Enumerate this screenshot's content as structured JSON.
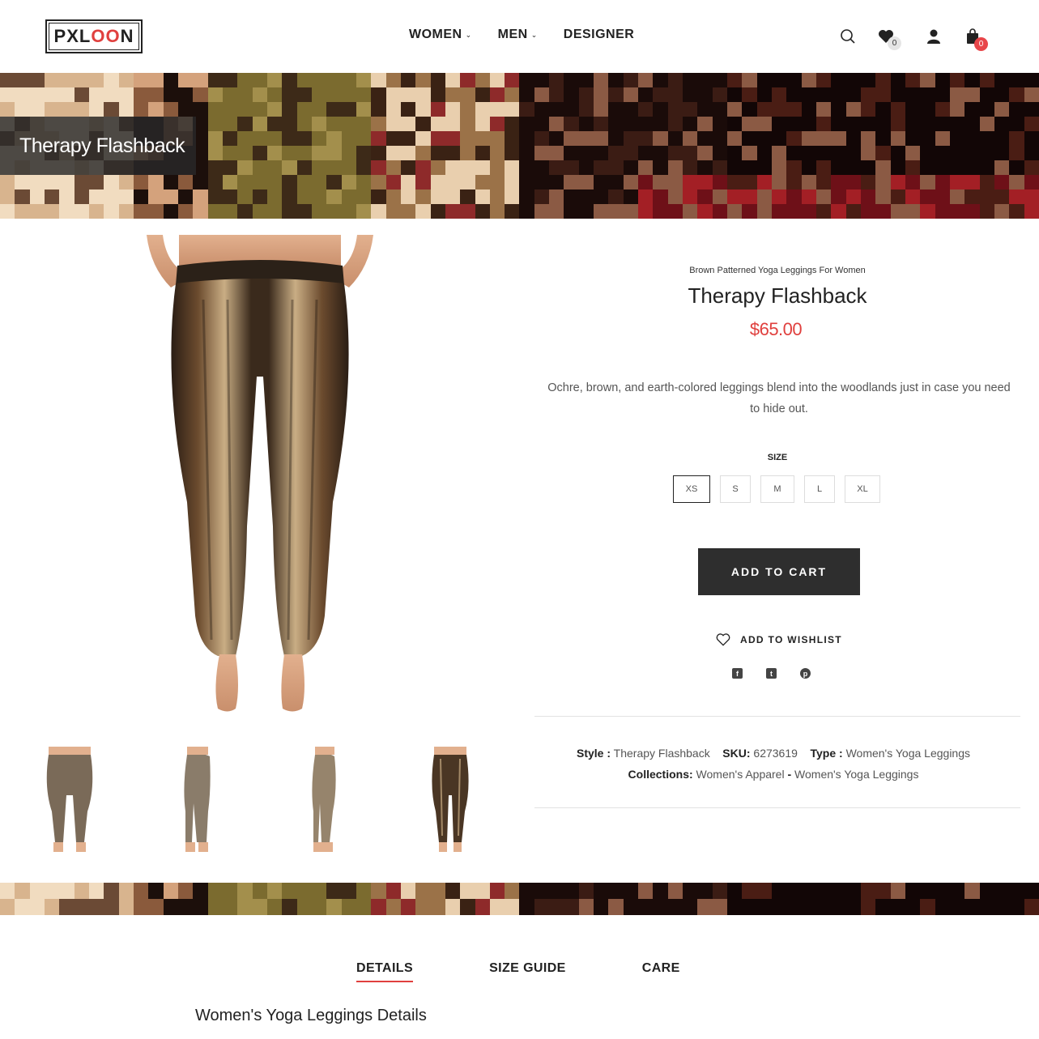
{
  "header": {
    "logo": {
      "text_left": "PXL",
      "text_oo": "OO",
      "text_right": "N"
    },
    "nav": [
      {
        "label": "WOMEN",
        "has_dropdown": true
      },
      {
        "label": "MEN",
        "has_dropdown": true
      },
      {
        "label": "DESIGNER",
        "has_dropdown": false
      }
    ],
    "icons": {
      "search": "search-icon",
      "wishlist": "heart-icon",
      "account": "user-icon",
      "cart": "bag-icon"
    },
    "wishlist_count": "0",
    "cart_count": "0"
  },
  "banner": {
    "title": "Therapy Flashback"
  },
  "product": {
    "category": "Brown Patterned Yoga Leggings For Women",
    "title": "Therapy Flashback",
    "price": "$65.00",
    "description": "Ochre, brown, and earth-colored leggings blend into the woodlands just in case you need to hide out.",
    "size_label": "SIZE",
    "sizes": [
      "XS",
      "S",
      "M",
      "L",
      "XL"
    ],
    "selected_size": "XS",
    "add_to_cart": "ADD TO CART",
    "add_to_wishlist": "ADD TO WISHLIST",
    "social": [
      "facebook-icon",
      "twitter-icon",
      "pinterest-icon"
    ],
    "meta": {
      "style_label": "Style :",
      "style_value": "Therapy Flashback",
      "sku_label": "SKU:",
      "sku_value": "6273619",
      "type_label": "Type :",
      "type_value": "Women's Yoga Leggings",
      "collections_label": "Collections:",
      "collection_1": "Women's Apparel",
      "collection_sep": "-",
      "collection_2": "Women's Yoga Leggings"
    }
  },
  "tabs": {
    "items": [
      "DETAILS",
      "SIZE GUIDE",
      "CARE"
    ],
    "active": "DETAILS"
  },
  "details_title": "Women's Yoga Leggings Details",
  "colors": {
    "accent": "#e0403e",
    "button": "#2e2e2e"
  }
}
